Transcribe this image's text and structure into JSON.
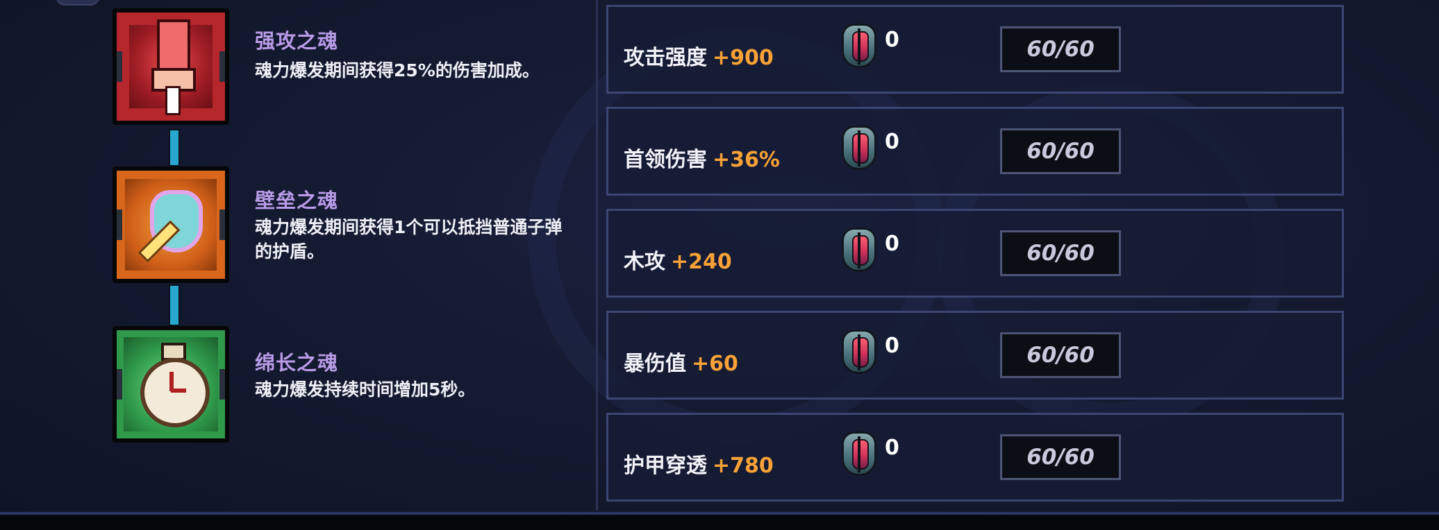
{
  "souls": [
    {
      "name": "强攻之魂",
      "description": "魂力爆发期间获得25%的伤害加成。",
      "icon": "red-sword-soul-icon",
      "color": "#c42a2c"
    },
    {
      "name": "壁垒之魂",
      "description": "魂力爆发期间获得1个可以抵挡普通子弹的护盾。",
      "icon": "orange-shield-soul-icon",
      "color": "#e07a20"
    },
    {
      "name": "绵长之魂",
      "description": "魂力爆发持续时间增加5秒。",
      "icon": "green-stopwatch-soul-icon",
      "color": "#2f9a4a"
    }
  ],
  "stats": [
    {
      "label": "攻击强度",
      "bonus": "+900",
      "count": "0",
      "progress": "60/60"
    },
    {
      "label": "首领伤害",
      "bonus": "+36%",
      "count": "0",
      "progress": "60/60"
    },
    {
      "label": "木攻",
      "bonus": "+240",
      "count": "0",
      "progress": "60/60"
    },
    {
      "label": "暴伤值",
      "bonus": "+60",
      "count": "0",
      "progress": "60/60"
    },
    {
      "label": "护甲穿透",
      "bonus": "+780",
      "count": "0",
      "progress": "60/60"
    }
  ],
  "colors": {
    "accent_bonus": "#f7a136",
    "soul_name": "#b99be8",
    "connector": "#27a6cf"
  },
  "item_icon": "shield-gem-icon"
}
